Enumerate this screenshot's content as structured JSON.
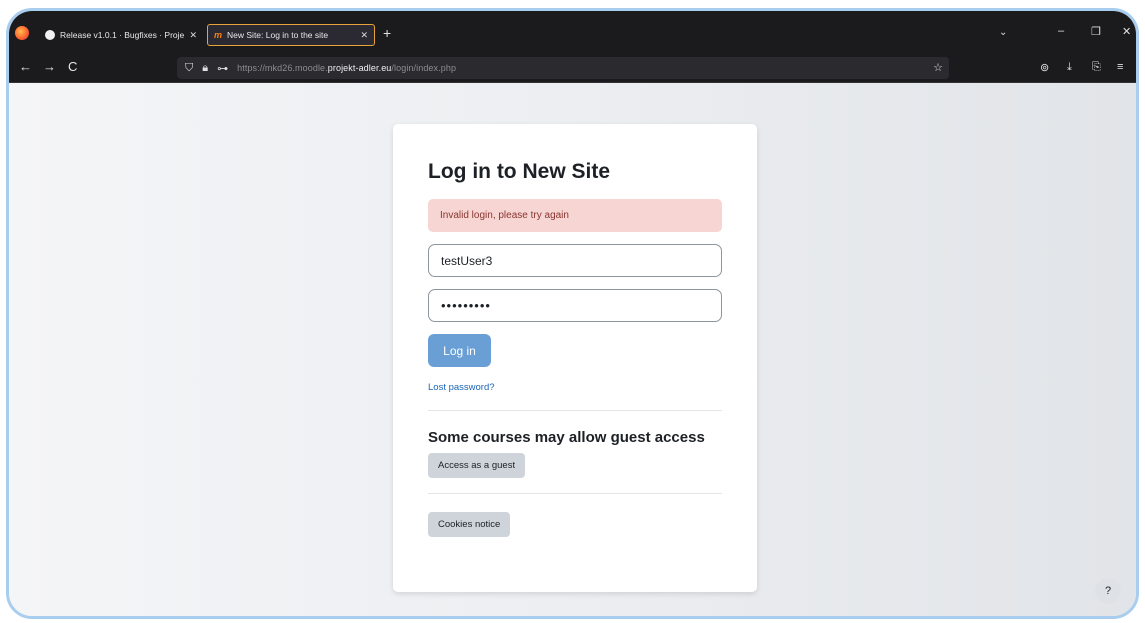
{
  "tabs": [
    {
      "label": "Release v1.0.1 · Bugfixes · Proje",
      "close": "✕",
      "icon": "github-icon",
      "active": false
    },
    {
      "label": "New Site: Log in to the site",
      "close": "✕",
      "icon": "moodle-icon",
      "active": true
    }
  ],
  "tabbar": {
    "new_tab": "+",
    "list_tabs": "⌄",
    "minimize": "–",
    "restore": "❐",
    "close": "✕"
  },
  "nav": {
    "back": "←",
    "forward": "→",
    "reload": "C",
    "url_prefix": "https://mkd26.moodle.",
    "url_domain": "projekt-adler.eu",
    "url_path": "/login/index.php",
    "bookmark": "☆",
    "pocket": "⊚",
    "download": "⤓",
    "extensions": "⎘",
    "menu": "≡"
  },
  "login": {
    "title": "Log in to New Site",
    "error": "Invalid login, please try again",
    "username_value": "testUser3",
    "password_mask": "•••••••••",
    "submit_label": "Log in",
    "lost_password": "Lost password?",
    "guest_heading": "Some courses may allow guest access",
    "guest_button": "Access as a guest",
    "cookies_button": "Cookies notice"
  },
  "help": {
    "label": "?"
  },
  "colors": {
    "primary": "#6a9fd6",
    "alert_bg": "#f6d5d3",
    "link": "#1a64b8",
    "tab_accent": "#e8a33d"
  }
}
